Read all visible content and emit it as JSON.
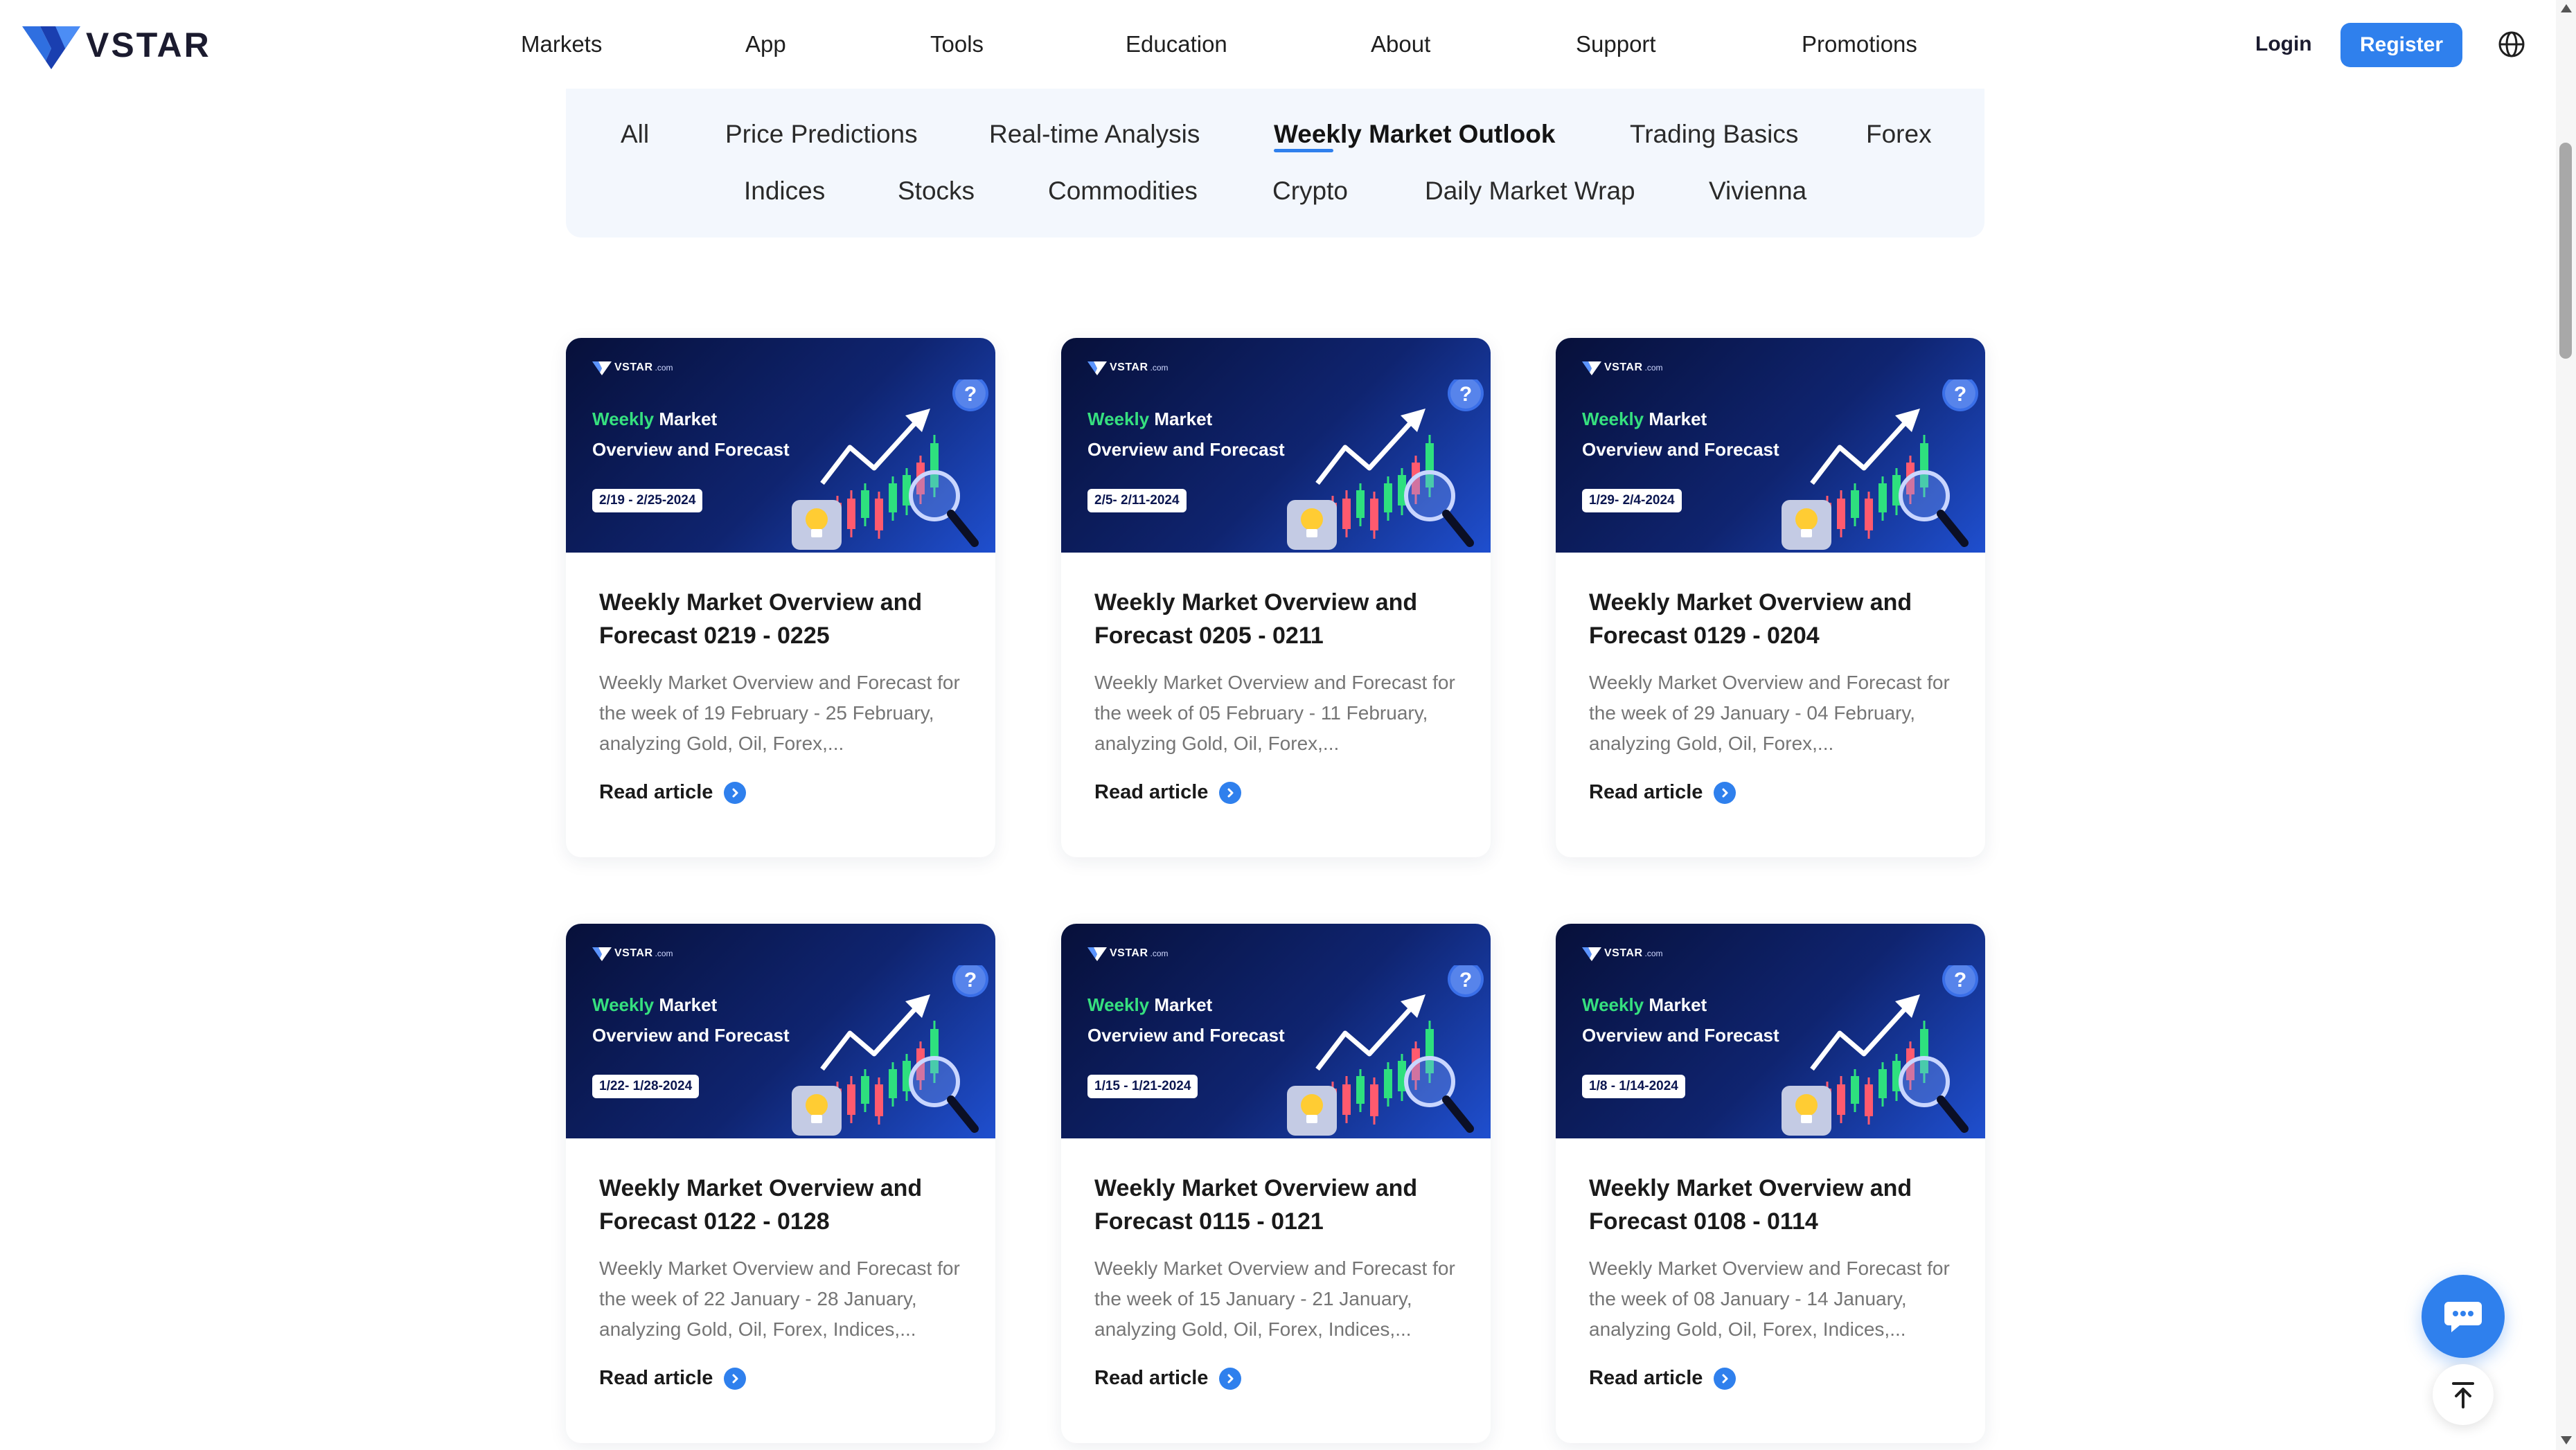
{
  "brand": {
    "name": "VSTAR"
  },
  "nav": {
    "items": [
      {
        "label": "Markets"
      },
      {
        "label": "App"
      },
      {
        "label": "Tools"
      },
      {
        "label": "Education"
      },
      {
        "label": "About"
      },
      {
        "label": "Support"
      },
      {
        "label": "Promotions"
      }
    ],
    "login_label": "Login",
    "register_label": "Register",
    "language_icon": "globe-icon"
  },
  "categories": {
    "active": "Weekly Market Outlook",
    "items": [
      {
        "label": "All"
      },
      {
        "label": "Price Predictions"
      },
      {
        "label": "Real-time Analysis"
      },
      {
        "label": "Weekly Market Outlook"
      },
      {
        "label": "Trading Basics"
      },
      {
        "label": "Forex"
      },
      {
        "label": "Indices"
      },
      {
        "label": "Stocks"
      },
      {
        "label": "Commodities"
      },
      {
        "label": "Crypto"
      },
      {
        "label": "Daily Market Wrap"
      },
      {
        "label": "Vivienna"
      }
    ]
  },
  "image_text": {
    "logo": "VSTAR",
    "logo_suffix": ".com",
    "green_word": "Weekly",
    "title_rest": "Market",
    "title_line2": "Overview and Forecast"
  },
  "articles": [
    {
      "image_date": "2/19 - 2/25-2024",
      "title": "Weekly Market Overview and Forecast 0219 - 0225",
      "description": "Weekly Market Overview and Forecast for the week of 19 February - 25 February, analyzing Gold, Oil, Forex,...",
      "link_label": "Read article"
    },
    {
      "image_date": "2/5- 2/11-2024",
      "title": "Weekly Market Overview and Forecast 0205 - 0211",
      "description": "Weekly Market Overview and Forecast for the week of 05 February - 11 February, analyzing Gold, Oil, Forex,...",
      "link_label": "Read article"
    },
    {
      "image_date": "1/29- 2/4-2024",
      "title": "Weekly Market Overview and Forecast 0129 - 0204",
      "description": "Weekly Market Overview and Forecast for the week of 29 January - 04 February, analyzing Gold, Oil, Forex,...",
      "link_label": "Read article"
    },
    {
      "image_date": "1/22- 1/28-2024",
      "title": "Weekly Market Overview and Forecast 0122 - 0128",
      "description": "Weekly Market Overview and Forecast for the week of 22 January - 28 January, analyzing Gold, Oil, Forex, Indices,...",
      "link_label": "Read article"
    },
    {
      "image_date": "1/15 - 1/21-2024",
      "title": "Weekly Market Overview and Forecast 0115 - 0121",
      "description": "Weekly Market Overview and Forecast for the week of 15 January - 21 January, analyzing Gold, Oil, Forex, Indices,...",
      "link_label": "Read article"
    },
    {
      "image_date": "1/8 - 1/14-2024",
      "title": "Weekly Market Overview and Forecast 0108 - 0114",
      "description": "Weekly Market Overview and Forecast for the week of 08 January - 14 January, analyzing Gold, Oil, Forex, Indices,...",
      "link_label": "Read article"
    }
  ],
  "floating": {
    "chat_icon": "chat-bubble-icon",
    "top_icon": "back-to-top-icon"
  },
  "colors": {
    "accent": "#2f80ed",
    "filter_background": "#f3f7fd",
    "image_dark": "#07103a",
    "image_green": "#36e07f"
  }
}
